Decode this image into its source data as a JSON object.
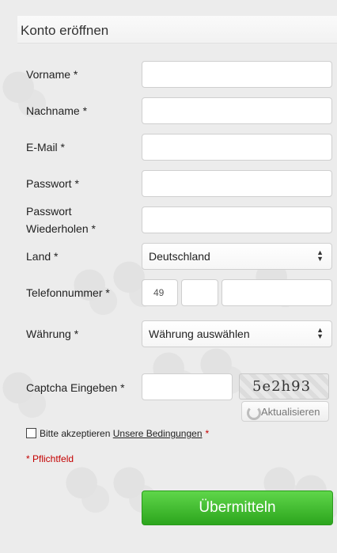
{
  "form": {
    "title": "Konto eröffnen",
    "fields": {
      "vorname": {
        "label": "Vorname *",
        "value": ""
      },
      "nachname": {
        "label": "Nachname *",
        "value": ""
      },
      "email": {
        "label": "E-Mail *",
        "value": ""
      },
      "passwort": {
        "label": "Passwort *",
        "value": ""
      },
      "passwort_wiederholen": {
        "label_line1": "Passwort",
        "label_line2": "Wiederholen *",
        "value": ""
      },
      "land": {
        "label": "Land *",
        "selected": "Deutschland"
      },
      "telefon": {
        "label": "Telefonnummer *",
        "country_code": "49",
        "area_code": "",
        "number": ""
      },
      "waehrung": {
        "label": "Währung *",
        "selected": "Währung auswählen"
      },
      "captcha": {
        "label": "Captcha Eingeben *",
        "value": "",
        "code": "5e2h93",
        "refresh_label": "Aktualisieren"
      }
    },
    "terms": {
      "text": "Bitte akzeptieren",
      "link": "Unsere Bedingungen",
      "required_mark": "*"
    },
    "required_note": "* Pflichtfeld",
    "submit_label": "Übermitteln"
  },
  "icons": {
    "refresh": "refresh-icon",
    "select_arrows": "updown-arrows-icon"
  },
  "colors": {
    "submit": "#3cb72a",
    "required": "#c40000",
    "background": "#ececec"
  }
}
